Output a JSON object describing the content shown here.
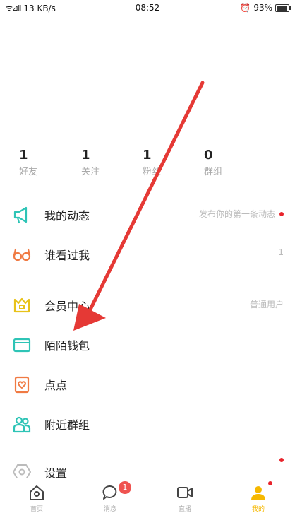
{
  "status_bar": {
    "signal": "ᯤ⊿ll",
    "speed": "13 KB/s",
    "time": "08:52",
    "alarm": "⏰",
    "battery": "93%",
    "battery_level": 0.93
  },
  "stats": [
    {
      "count": "1",
      "label": "好友"
    },
    {
      "count": "1",
      "label": "关注"
    },
    {
      "count": "1",
      "label": "粉丝"
    },
    {
      "count": "0",
      "label": "群组"
    }
  ],
  "menu": [
    {
      "label": "我的动态",
      "right": "发布你的第一条动态",
      "dot": true,
      "icon": "megaphone-icon"
    },
    {
      "label": "谁看过我",
      "right": "1",
      "dot": false,
      "icon": "glasses-icon"
    },
    {
      "label": "会员中心",
      "right": "普通用户",
      "dot": false,
      "icon": "crown-icon"
    },
    {
      "label": "陌陌钱包",
      "right": "",
      "dot": false,
      "icon": "wallet-icon"
    },
    {
      "label": "点点",
      "right": "",
      "dot": false,
      "icon": "heart-card-icon"
    },
    {
      "label": "附近群组",
      "right": "",
      "dot": false,
      "icon": "group-icon"
    },
    {
      "label": "设置",
      "right": "",
      "dot": true,
      "icon": "settings-icon"
    }
  ],
  "tabs": [
    {
      "label": "首页",
      "icon": "home-icon"
    },
    {
      "label": "消息",
      "icon": "message-icon",
      "badge": "1"
    },
    {
      "label": "直播",
      "icon": "video-icon"
    },
    {
      "label": "我的",
      "icon": "profile-icon",
      "active": true
    }
  ],
  "colors": {
    "accent": "#f6b800",
    "teal": "#2ec4b6",
    "orange": "#f07a43",
    "yellow": "#e8c21a",
    "arrow": "#e53935",
    "reddot": "#e8242c"
  }
}
